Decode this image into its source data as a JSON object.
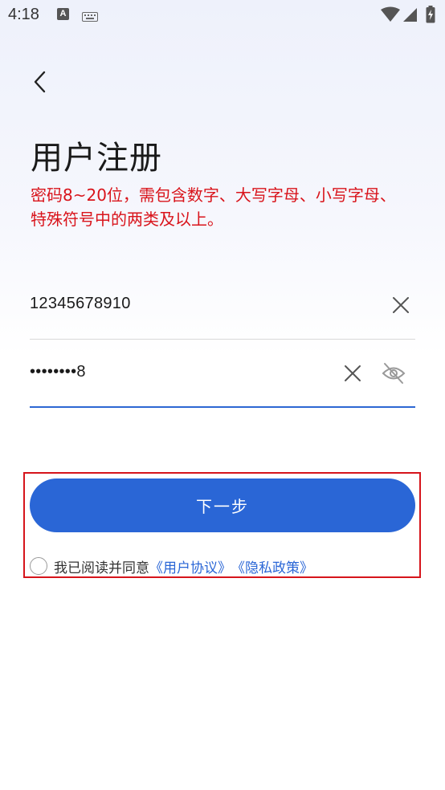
{
  "status_bar": {
    "time": "4:18",
    "keyboard_badge": "A"
  },
  "header": {
    "title": "用户注册",
    "hint": "密码8~20位，需包含数字、大写字母、小写字母、特殊符号中的两类及以上。"
  },
  "form": {
    "phone_value": "12345678910",
    "password_value": "••••••••8"
  },
  "actions": {
    "next_label": "下一步"
  },
  "agreement": {
    "prefix": "我已阅读并同意",
    "user_agreement": "《用户协议》",
    "privacy_policy": "《隐私政策》"
  },
  "colors": {
    "accent": "#2a66d6",
    "hint_red": "#d9141b",
    "highlight_red": "#d6141b"
  }
}
